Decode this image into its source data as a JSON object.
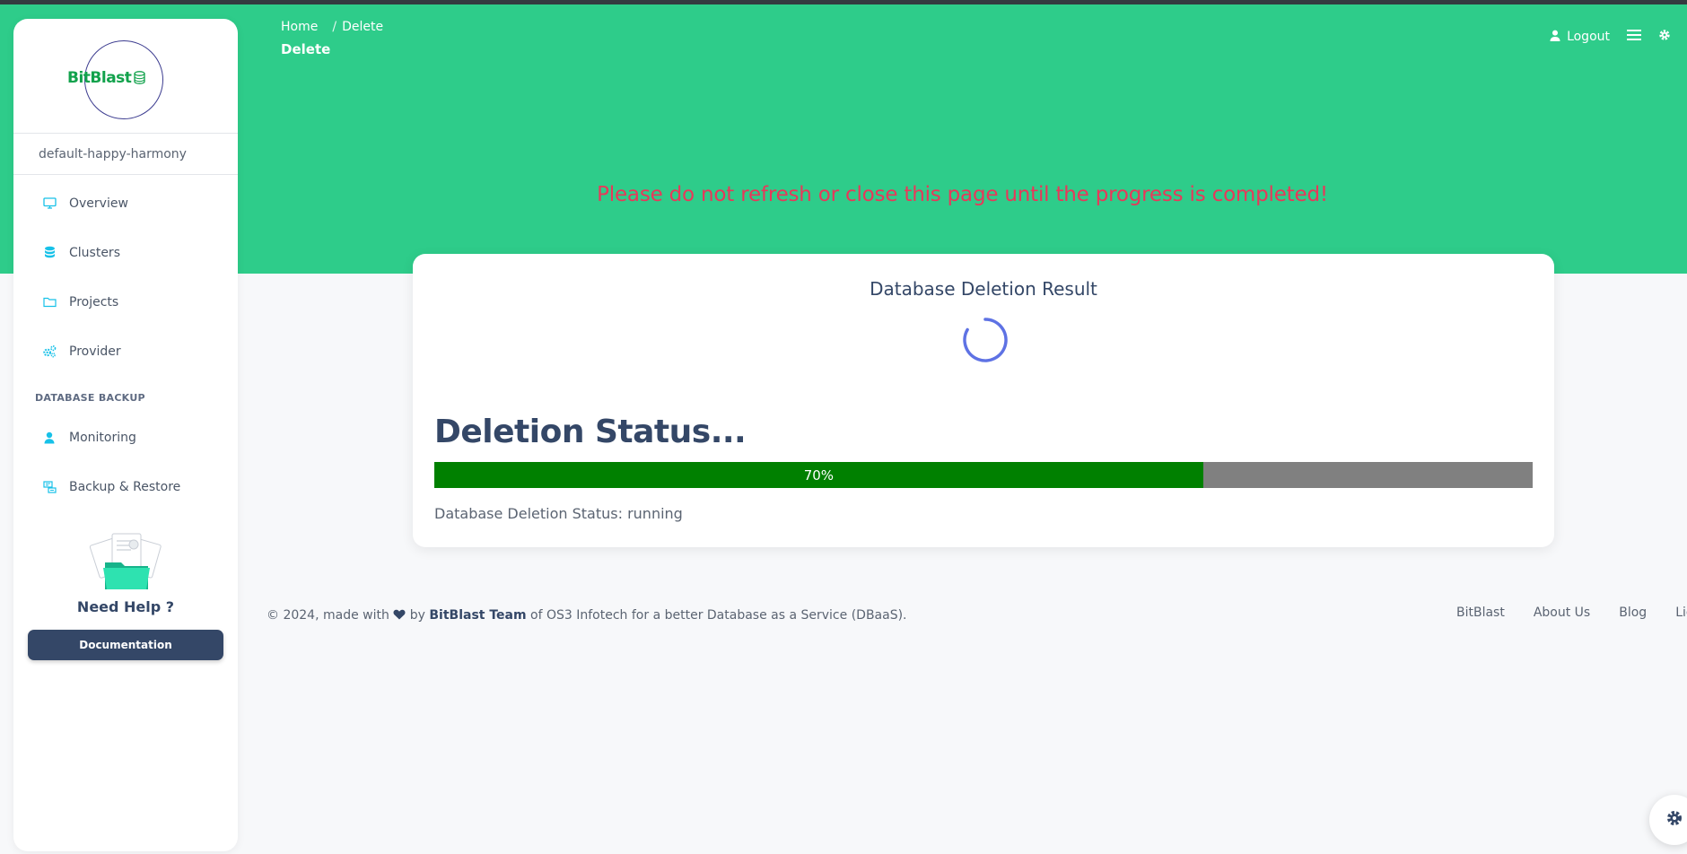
{
  "brand": {
    "name": "BitBlast"
  },
  "sidebar": {
    "workspace": "default-happy-harmony",
    "items": [
      {
        "label": "Overview",
        "icon": "monitor-icon"
      },
      {
        "label": "Clusters",
        "icon": "database-icon"
      },
      {
        "label": "Projects",
        "icon": "folder-icon"
      },
      {
        "label": "Provider",
        "icon": "cogs-icon"
      }
    ],
    "section_title": "DATABASE BACKUP",
    "backup_items": [
      {
        "label": "Monitoring",
        "icon": "user-icon"
      },
      {
        "label": "Backup & Restore",
        "icon": "backup-icon"
      }
    ],
    "help": {
      "title": "Need Help ?",
      "button": "Documentation"
    }
  },
  "header": {
    "breadcrumb": {
      "home": "Home",
      "separator": "/",
      "current": "Delete"
    },
    "title": "Delete",
    "logout": "Logout"
  },
  "warning": "Please do not refresh or close this page until the progress is completed!",
  "card": {
    "title": "Database Deletion Result",
    "status_heading": "Deletion Status...",
    "progress": {
      "value": 70,
      "label": "70%"
    },
    "status_line": "Database Deletion Status: running"
  },
  "footer": {
    "copyright_prefix": "© 2024, made with",
    "by": "by",
    "team": "BitBlast Team",
    "suffix": "of OS3 Infotech for a better Database as a Service (DBaaS).",
    "links": [
      "BitBlast",
      "About Us",
      "Blog",
      "License"
    ]
  },
  "colors": {
    "hero": "#2ecc8a",
    "warning": "#e8385a",
    "progress_fill": "#008000",
    "progress_track": "#808080",
    "primary_dark": "#344767",
    "icon_accent": "#17c1e8",
    "spinner": "#5e72e4"
  }
}
